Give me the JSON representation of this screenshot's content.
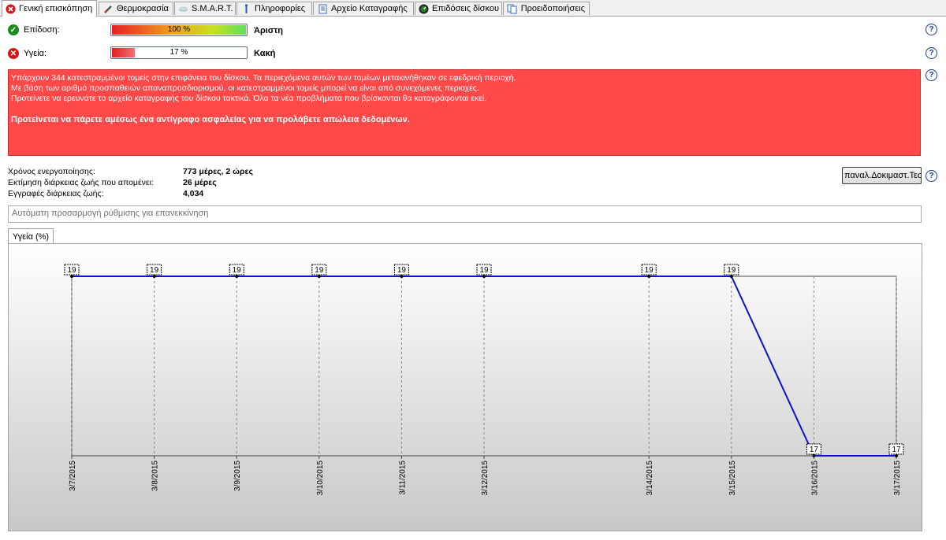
{
  "tabs": [
    {
      "label": "Γενική επισκόπηση",
      "icon": "error-circle-icon",
      "active": true
    },
    {
      "label": "Θερμοκρασία",
      "icon": "thermometer-icon",
      "active": false
    },
    {
      "label": "S.M.A.R.T.",
      "icon": "smart-icon",
      "active": false
    },
    {
      "label": "Πληροφορίες",
      "icon": "info-icon",
      "active": false
    },
    {
      "label": "Αρχείο Καταγραφής",
      "icon": "log-file-icon",
      "active": false
    },
    {
      "label": "Επιδόσεις δίσκου",
      "icon": "speedometer-icon",
      "active": false
    },
    {
      "label": "Προειδοποιήσεις",
      "icon": "alerts-icon",
      "active": false
    }
  ],
  "performance": {
    "label": "Επίδοση:",
    "value": "100 %",
    "percent": 100,
    "verdict": "Άριστη"
  },
  "health": {
    "label": "Υγεία:",
    "value": "17 %",
    "percent": 17,
    "verdict": "Κακή"
  },
  "alert": {
    "line1": "Υπάρχουν 344 κατεστραμμένοι τομείς στην επιφάνεια του δίσκου. Τα περιεχόμενα αυτών των τομέων μετακινήθηκαν σε εφεδρική περιοχή.",
    "line2": "Με βάση των αριθμό προσπαθειών απαναπροσδιορισμού, οι κατεστραμμένοι τομείς μπορεί να είναι από συνεχόμενες περιοχές.",
    "line3": "Προτείνετε να ερευνάτε το αρχείο καταγραφής του δίσκου τακτικά. Όλα τα νέα προβλήματα που βρίσκονται θα καταγράφονται εκεί.",
    "bold": "Προτείνεται να πάρετε αμέσως ένα αντίγραφο ασφαλείας για να προλάβετε απώλεια δεδομένων."
  },
  "info": {
    "power_on_label": "Χρόνος ενεργοποίησης:",
    "power_on_value": "773 μέρες, 2 ώρες",
    "remaining_label": "Εκτίμηση διάρκειας ζωής που απομένει:",
    "remaining_value": "26 μέρες",
    "records_label": "Εγγραφές διάρκειας ζωής:",
    "records_value": "4,034"
  },
  "retest_button": "παναλ.Δοκιμαστ.Τεστ",
  "comment_placeholder": "Αυτόματη προσαρμογή ρύθμισης για επανεκκίνηση",
  "graph_tab": "Υγεία (%)",
  "chart_data": {
    "type": "line",
    "x": [
      "3/7/2015",
      "3/8/2015",
      "3/9/2015",
      "3/10/2015",
      "3/11/2015",
      "3/12/2015",
      "3/14/2015",
      "3/15/2015",
      "3/16/2015",
      "3/17/2015"
    ],
    "series": [
      {
        "values": [
          19,
          19,
          19,
          19,
          19,
          19,
          19,
          19,
          17,
          17
        ]
      }
    ],
    "ylim": [
      17,
      19
    ],
    "grid": true,
    "line_color": "#1010d0"
  }
}
